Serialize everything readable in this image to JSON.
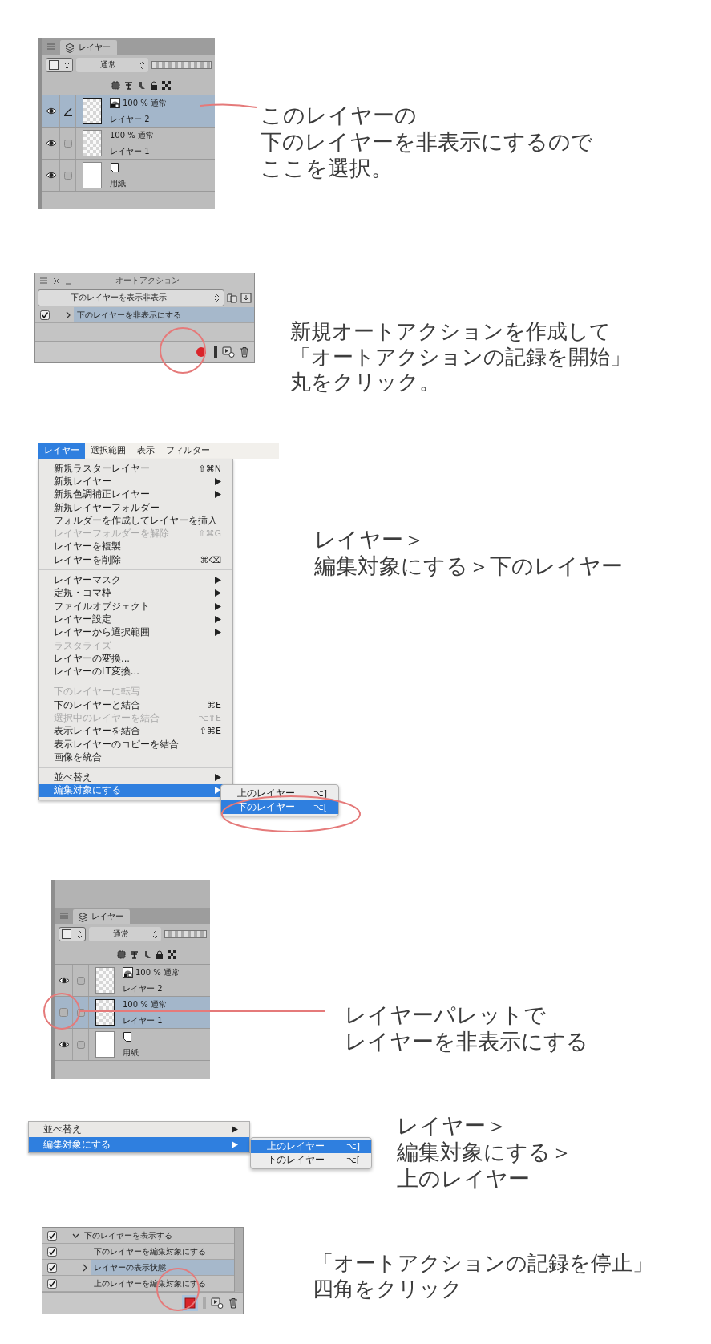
{
  "steps": [
    {
      "kind": "layer_panel",
      "tab": "レイヤー",
      "blend_mode": "通常",
      "layers": [
        {
          "kind": "raster",
          "mode": "100 % 通常",
          "name": "レイヤー 2",
          "visible": true,
          "selected": true,
          "editing": true,
          "mode_icon": true
        },
        {
          "kind": "raster",
          "mode": "100 % 通常",
          "name": "レイヤー 1",
          "visible": true,
          "selected": false,
          "editing": false,
          "mode_icon": false
        },
        {
          "kind": "paper",
          "name": "用紙",
          "visible": true,
          "selected": false,
          "editing": false
        }
      ],
      "caption": [
        "このレイヤーの",
        "下のレイヤーを非表示にするので",
        "ここを選択。"
      ]
    },
    {
      "kind": "auto_action",
      "title": "オートアクション",
      "set": "下のレイヤーを表示非表示",
      "actions": [
        {
          "label": "下のレイヤーを非表示にする",
          "checked": true,
          "selected": true,
          "expanded": false
        }
      ],
      "recording": false,
      "caption": [
        "新規オートアクションを作成して",
        "「オートアクションの記録を開始」",
        "丸をクリック。"
      ]
    },
    {
      "kind": "menu",
      "menubar": [
        {
          "label": "レイヤー",
          "selected": true
        },
        {
          "label": "選択範囲",
          "selected": false
        },
        {
          "label": "表示",
          "selected": false
        },
        {
          "label": "フィルター",
          "selected": false
        }
      ],
      "items": [
        {
          "kind": "item",
          "label": "新規ラスターレイヤー",
          "shortcut": "⇧⌘N",
          "disabled": false,
          "submenu": false,
          "selected": false
        },
        {
          "kind": "item",
          "label": "新規レイヤー",
          "disabled": false,
          "submenu": true,
          "selected": false
        },
        {
          "kind": "item",
          "label": "新規色調補正レイヤー",
          "disabled": false,
          "submenu": true,
          "selected": false
        },
        {
          "kind": "item",
          "label": "新規レイヤーフォルダー",
          "disabled": false,
          "submenu": false,
          "selected": false
        },
        {
          "kind": "item",
          "label": "フォルダーを作成してレイヤーを挿入",
          "disabled": false,
          "submenu": false,
          "selected": false
        },
        {
          "kind": "item",
          "label": "レイヤーフォルダーを解除",
          "shortcut": "⇧⌘G",
          "disabled": true,
          "submenu": false,
          "selected": false
        },
        {
          "kind": "item",
          "label": "レイヤーを複製",
          "disabled": false,
          "submenu": false,
          "selected": false
        },
        {
          "kind": "item",
          "label": "レイヤーを削除",
          "shortcut": "⌘⌫",
          "disabled": false,
          "submenu": false,
          "selected": false
        },
        {
          "kind": "separator"
        },
        {
          "kind": "item",
          "label": "レイヤーマスク",
          "disabled": false,
          "submenu": true,
          "selected": false
        },
        {
          "kind": "item",
          "label": "定規・コマ枠",
          "disabled": false,
          "submenu": true,
          "selected": false
        },
        {
          "kind": "item",
          "label": "ファイルオブジェクト",
          "disabled": false,
          "submenu": true,
          "selected": false
        },
        {
          "kind": "item",
          "label": "レイヤー設定",
          "disabled": false,
          "submenu": true,
          "selected": false
        },
        {
          "kind": "item",
          "label": "レイヤーから選択範囲",
          "disabled": false,
          "submenu": true,
          "selected": false
        },
        {
          "kind": "item",
          "label": "ラスタライズ",
          "disabled": true,
          "submenu": false,
          "selected": false
        },
        {
          "kind": "item",
          "label": "レイヤーの変換...",
          "disabled": false,
          "submenu": false,
          "selected": false
        },
        {
          "kind": "item",
          "label": "レイヤーのLT変換...",
          "disabled": false,
          "submenu": false,
          "selected": false
        },
        {
          "kind": "separator"
        },
        {
          "kind": "item",
          "label": "下のレイヤーに転写",
          "disabled": true,
          "submenu": false,
          "selected": false
        },
        {
          "kind": "item",
          "label": "下のレイヤーと結合",
          "shortcut": "⌘E",
          "disabled": false,
          "submenu": false,
          "selected": false
        },
        {
          "kind": "item",
          "label": "選択中のレイヤーを結合",
          "shortcut": "⌥⇧E",
          "disabled": true,
          "submenu": false,
          "selected": false
        },
        {
          "kind": "item",
          "label": "表示レイヤーを結合",
          "shortcut": "⇧⌘E",
          "disabled": false,
          "submenu": false,
          "selected": false
        },
        {
          "kind": "item",
          "label": "表示レイヤーのコピーを結合",
          "disabled": false,
          "submenu": false,
          "selected": false
        },
        {
          "kind": "item",
          "label": "画像を統合",
          "disabled": false,
          "submenu": false,
          "selected": false
        },
        {
          "kind": "separator"
        },
        {
          "kind": "item",
          "label": "並べ替え",
          "disabled": false,
          "submenu": true,
          "selected": false
        },
        {
          "kind": "item",
          "label": "編集対象にする",
          "disabled": false,
          "submenu": true,
          "selected": true
        }
      ],
      "submenu": [
        {
          "label": "上のレイヤー",
          "shortcut": "⌥]",
          "selected": false
        },
        {
          "label": "下のレイヤー",
          "shortcut": "⌥[",
          "selected": true
        }
      ],
      "caption": [
        "レイヤー＞",
        "編集対象にする＞下のレイヤー"
      ]
    },
    {
      "kind": "layer_panel",
      "tab": "レイヤー",
      "blend_mode": "通常",
      "layers": [
        {
          "kind": "raster",
          "mode": "100 % 通常",
          "name": "レイヤー 2",
          "visible": true,
          "selected": false,
          "editing": false,
          "mode_icon": true
        },
        {
          "kind": "raster",
          "mode": "100 % 通常",
          "name": "レイヤー 1",
          "visible": false,
          "selected": true,
          "editing": false,
          "mode_icon": false
        },
        {
          "kind": "paper",
          "name": "用紙",
          "visible": true,
          "selected": false,
          "editing": false
        }
      ],
      "caption": [
        "レイヤーパレットで",
        "レイヤーを非表示にする"
      ]
    },
    {
      "kind": "menu",
      "items": [
        {
          "kind": "item",
          "label": "並べ替え",
          "disabled": false,
          "submenu": true,
          "selected": false
        },
        {
          "kind": "item",
          "label": "編集対象にする",
          "disabled": false,
          "submenu": true,
          "selected": true
        }
      ],
      "submenu": [
        {
          "label": "上のレイヤー",
          "shortcut": "⌥]",
          "selected": true
        },
        {
          "label": "下のレイヤー",
          "shortcut": "⌥[",
          "selected": false
        }
      ],
      "caption": [
        "レイヤー＞",
        "編集対象にする＞",
        "上のレイヤー"
      ]
    },
    {
      "kind": "action_list",
      "actions": [
        {
          "label": "下のレイヤーを表示する",
          "checked": true,
          "selected": false,
          "expanded": true,
          "children": [
            {
              "label": "下のレイヤーを編集対象にする",
              "checked": true,
              "selected": false
            },
            {
              "label": "レイヤーの表示状態",
              "checked": true,
              "selected": true,
              "expanded": false
            },
            {
              "label": "上のレイヤーを編集対象にする",
              "checked": true,
              "selected": false
            }
          ]
        }
      ],
      "recording": true,
      "caption": [
        "「オートアクションの記録を停止」",
        "四角をクリック"
      ]
    }
  ]
}
